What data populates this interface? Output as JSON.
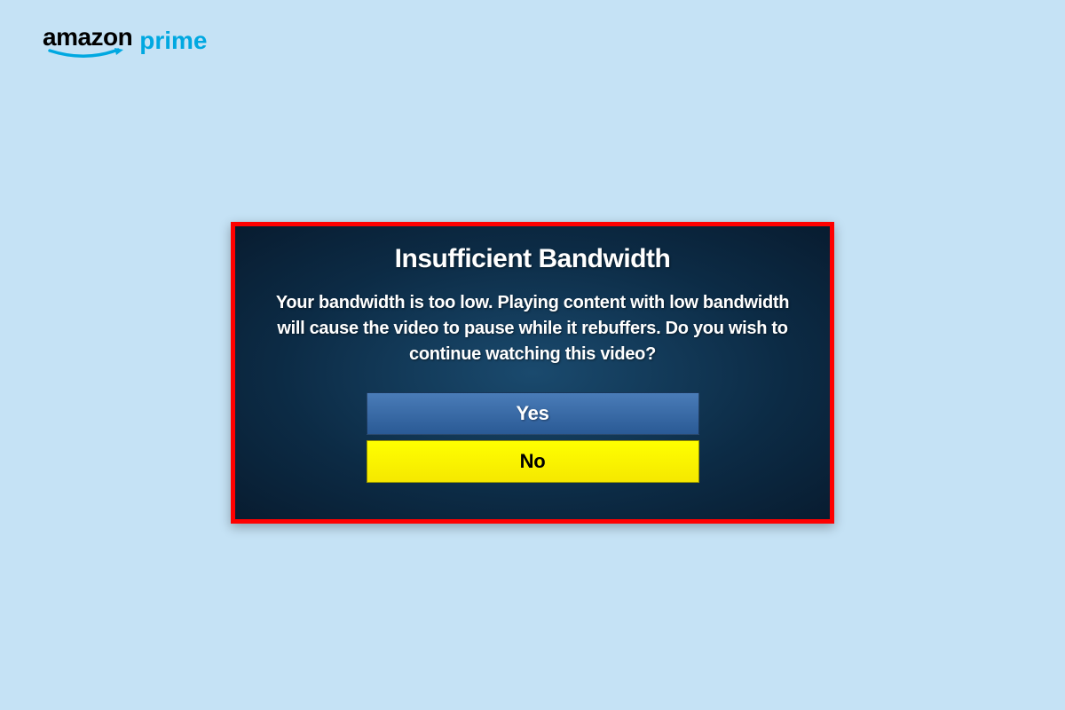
{
  "logo": {
    "amazon_text": "amazon",
    "prime_text": "prime"
  },
  "dialog": {
    "title": "Insufficient Bandwidth",
    "message": "Your bandwidth is too low. Playing content with low bandwidth will cause the video to pause while it rebuffers. Do you wish to continue watching this video?",
    "yes_label": "Yes",
    "no_label": "No"
  },
  "colors": {
    "background": "#c5e2f5",
    "dialog_border": "#ff0000",
    "prime_blue": "#00a8e1",
    "highlight_yellow": "#ffff00"
  }
}
